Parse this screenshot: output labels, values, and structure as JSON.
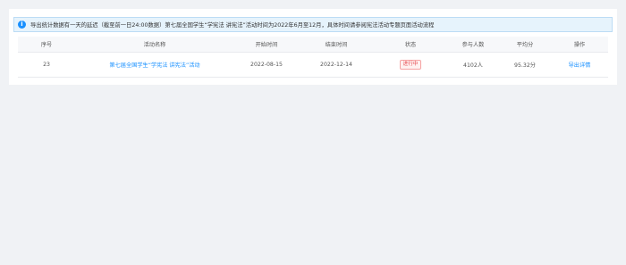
{
  "notice": {
    "icon": "info-icon",
    "icon_glyph": "i",
    "text": "导出统计数据有一天的延迟（截至前一日24:00数据）第七届全国学生“学宪法 讲宪法”活动时间为2022年6月至12月，具体时间请参阅宪法活动专题页面活动流程"
  },
  "table": {
    "headers": [
      "序号",
      "活动名称",
      "开始时间",
      "结束时间",
      "状态",
      "参与人数",
      "平均分",
      "操作"
    ],
    "rows": [
      {
        "index": "23",
        "name": "第七届全国学生“学宪法 讲宪法”活动",
        "start": "2022-08-15",
        "end": "2022-12-14",
        "status": "进行中",
        "participants": "4102人",
        "avg_score": "95.32分",
        "action": "导出详情"
      }
    ]
  },
  "colors": {
    "link": "#1890ff",
    "status_in_progress": "#e5484d",
    "notice_bg": "#e6f3fc"
  }
}
